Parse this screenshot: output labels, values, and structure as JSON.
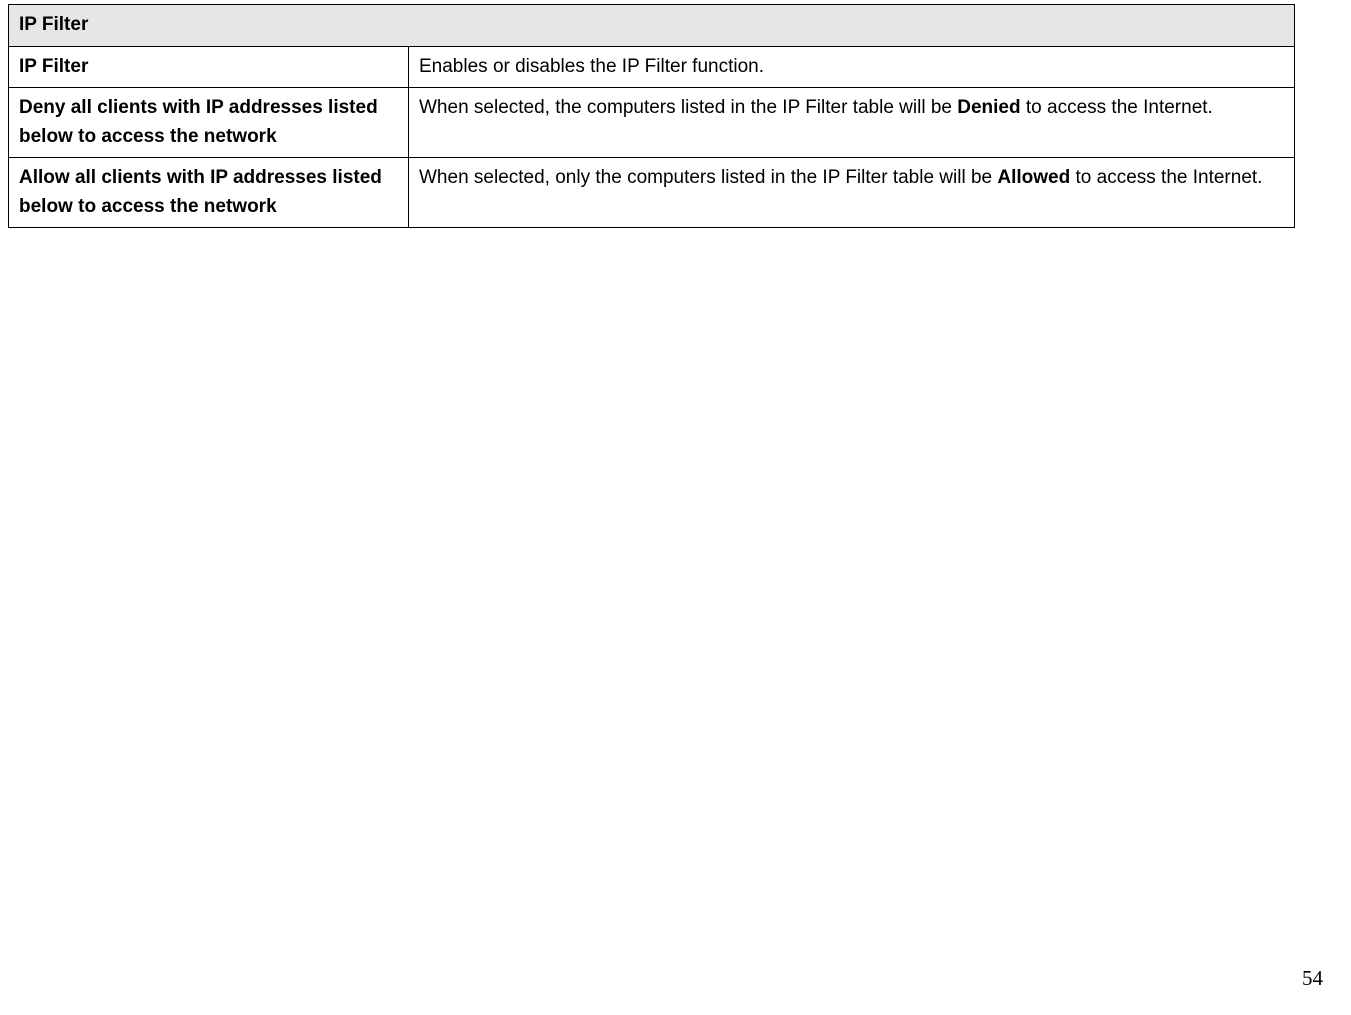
{
  "table": {
    "header": "IP Filter",
    "rows": [
      {
        "label": "IP Filter",
        "desc_pre": "Enables or disables the IP Filter function.",
        "desc_bold": "",
        "desc_post": ""
      },
      {
        "label": "Deny all clients with IP addresses listed below to access the network",
        "desc_pre": "When selected, the computers listed in the IP Filter table will be ",
        "desc_bold": "Denied",
        "desc_post": " to access the Internet."
      },
      {
        "label": "Allow all clients with IP addresses listed below to access the network",
        "desc_pre": "When selected, only the computers listed in the IP Filter table will be ",
        "desc_bold": "Allowed",
        "desc_post": " to access the Internet."
      }
    ]
  },
  "page_number": "54"
}
